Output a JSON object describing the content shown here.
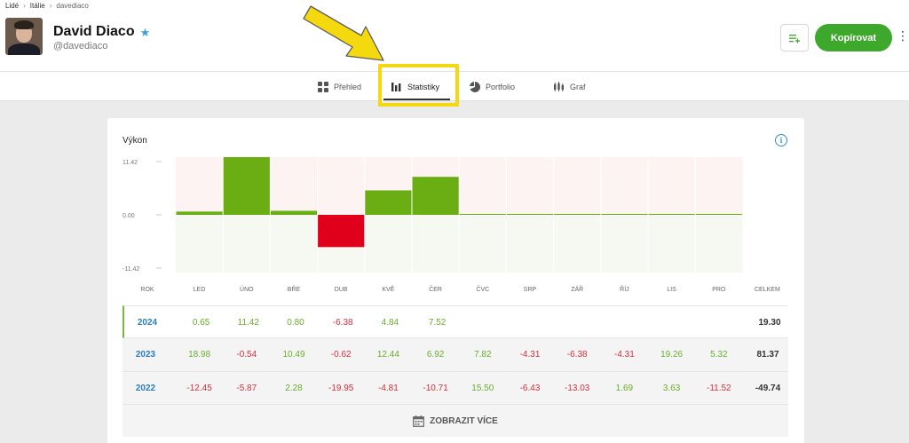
{
  "breadcrumb": {
    "people": "Lidé",
    "country": "Itálie",
    "user": "davediaco"
  },
  "user": {
    "name": "David Diaco",
    "handle": "@davediaco"
  },
  "actions": {
    "copy_label": "Kopírovat"
  },
  "tabs": [
    {
      "label": "Přehled",
      "icon": "overview-icon"
    },
    {
      "label": "Statistiky",
      "icon": "stats-icon"
    },
    {
      "label": "Portfolio",
      "icon": "pie-icon"
    },
    {
      "label": "Graf",
      "icon": "chart-icon"
    }
  ],
  "card": {
    "title": "Výkon"
  },
  "colors": {
    "positive": "#6aae2c",
    "negative": "#e0001b",
    "accent": "#3ea82c",
    "link": "#2a7fc0"
  },
  "chart_data": {
    "type": "bar",
    "title": "Výkon",
    "categories": [
      "LED",
      "ÚNO",
      "BŘE",
      "DUB",
      "KVĚ",
      "ČER",
      "ČVC",
      "SRP",
      "ZÁŘ",
      "ŘÍJ",
      "LIS",
      "PRO"
    ],
    "values": [
      0.65,
      11.42,
      0.8,
      -6.38,
      4.84,
      7.52,
      0,
      0,
      0,
      0,
      0,
      0
    ],
    "y_ticks": [
      "11.42",
      "0.00",
      "-11.42"
    ],
    "ylim": [
      -11.42,
      11.42
    ],
    "grid": true
  },
  "table": {
    "year_header": "ROK",
    "total_header": "CELKEM",
    "rows": [
      {
        "year": "2024",
        "values": [
          "0.65",
          "11.42",
          "0.80",
          "-6.38",
          "4.84",
          "7.52",
          "",
          "",
          "",
          "",
          "",
          ""
        ],
        "total": "19.30"
      },
      {
        "year": "2023",
        "values": [
          "18.98",
          "-0.54",
          "10.49",
          "-0.62",
          "12.44",
          "6.92",
          "7.82",
          "-4.31",
          "-6.38",
          "-4.31",
          "19.26",
          "5.32"
        ],
        "total": "81.37"
      },
      {
        "year": "2022",
        "values": [
          "-12.45",
          "-5.87",
          "2.28",
          "-19.95",
          "-4.81",
          "-10.71",
          "15.50",
          "-6.43",
          "-13.03",
          "1.69",
          "3.63",
          "-11.52"
        ],
        "total": "-49.74"
      }
    ]
  },
  "show_more": {
    "label": "ZOBRAZIT VÍCE"
  }
}
